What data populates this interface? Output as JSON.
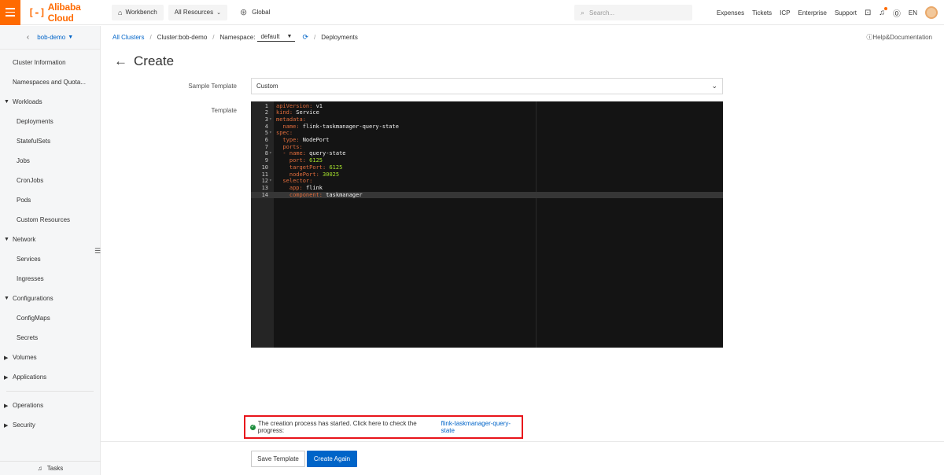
{
  "topbar": {
    "brand": "Alibaba Cloud",
    "workbench": "Workbench",
    "all_resources": "All Resources",
    "region": "Global",
    "search_placeholder": "Search...",
    "links": [
      "Expenses",
      "Tickets",
      "ICP",
      "Enterprise",
      "Support"
    ],
    "language": "EN",
    "brand_color": "#ff6a00"
  },
  "sidebar": {
    "cluster": "bob-demo",
    "items": [
      {
        "label": "Cluster Information",
        "level": "top"
      },
      {
        "label": "Namespaces and Quota...",
        "level": "top"
      },
      {
        "label": "Workloads",
        "level": "group",
        "expanded": true
      },
      {
        "label": "Deployments",
        "level": "sub"
      },
      {
        "label": "StatefulSets",
        "level": "sub"
      },
      {
        "label": "Jobs",
        "level": "sub"
      },
      {
        "label": "CronJobs",
        "level": "sub"
      },
      {
        "label": "Pods",
        "level": "sub"
      },
      {
        "label": "Custom Resources",
        "level": "sub"
      },
      {
        "label": "Network",
        "level": "group",
        "expanded": true
      },
      {
        "label": "Services",
        "level": "sub"
      },
      {
        "label": "Ingresses",
        "level": "sub"
      },
      {
        "label": "Configurations",
        "level": "group",
        "expanded": true
      },
      {
        "label": "ConfigMaps",
        "level": "sub"
      },
      {
        "label": "Secrets",
        "level": "sub"
      },
      {
        "label": "Volumes",
        "level": "group",
        "expanded": false
      },
      {
        "label": "Applications",
        "level": "group",
        "expanded": false
      },
      {
        "label": "Operations",
        "level": "group",
        "expanded": false
      },
      {
        "label": "Security",
        "level": "group",
        "expanded": false
      }
    ],
    "tasks": "Tasks"
  },
  "breadcrumb": {
    "all_clusters": "All Clusters",
    "cluster": "Cluster:bob-demo",
    "namespace_label": "Namespace:",
    "namespace_value": "default",
    "current": "Deployments"
  },
  "help": "Help&Documentation",
  "page": {
    "title": "Create",
    "sample_template_label": "Sample Template",
    "sample_template_value": "Custom",
    "template_label": "Template"
  },
  "editor": {
    "lines": [
      {
        "num": "1",
        "fold": false,
        "parts": [
          [
            "k",
            "apiVersion: "
          ],
          [
            "s",
            "v1"
          ]
        ]
      },
      {
        "num": "2",
        "fold": false,
        "parts": [
          [
            "k",
            "kind: "
          ],
          [
            "s",
            "Service"
          ]
        ]
      },
      {
        "num": "3",
        "fold": true,
        "parts": [
          [
            "k",
            "metadata:"
          ]
        ]
      },
      {
        "num": "4",
        "fold": false,
        "parts": [
          [
            "k",
            "  name: "
          ],
          [
            "s",
            "flink-taskmanager-query-state"
          ]
        ]
      },
      {
        "num": "5",
        "fold": true,
        "parts": [
          [
            "k",
            "spec:"
          ]
        ]
      },
      {
        "num": "6",
        "fold": false,
        "parts": [
          [
            "k",
            "  type: "
          ],
          [
            "s",
            "NodePort"
          ]
        ]
      },
      {
        "num": "7",
        "fold": false,
        "parts": [
          [
            "k",
            "  ports:"
          ]
        ]
      },
      {
        "num": "8",
        "fold": true,
        "parts": [
          [
            "k",
            "  - name: "
          ],
          [
            "s",
            "query-state"
          ]
        ]
      },
      {
        "num": "9",
        "fold": false,
        "parts": [
          [
            "k",
            "    port: "
          ],
          [
            "n",
            "6125"
          ]
        ]
      },
      {
        "num": "10",
        "fold": false,
        "parts": [
          [
            "k",
            "    targetPort: "
          ],
          [
            "n",
            "6125"
          ]
        ]
      },
      {
        "num": "11",
        "fold": false,
        "parts": [
          [
            "k",
            "    nodePort: "
          ],
          [
            "n",
            "30025"
          ]
        ]
      },
      {
        "num": "12",
        "fold": true,
        "parts": [
          [
            "k",
            "  selector:"
          ]
        ]
      },
      {
        "num": "13",
        "fold": false,
        "parts": [
          [
            "k",
            "    app: "
          ],
          [
            "s",
            "flink"
          ]
        ]
      },
      {
        "num": "14",
        "fold": false,
        "parts": [
          [
            "k",
            "    component: "
          ],
          [
            "s",
            "taskmanager"
          ]
        ],
        "active": true
      }
    ]
  },
  "notice": {
    "text": "The creation process has started. Click here to check the progress:",
    "link": "flink-taskmanager-query-state"
  },
  "buttons": {
    "save_template": "Save Template",
    "create_again": "Create Again"
  }
}
